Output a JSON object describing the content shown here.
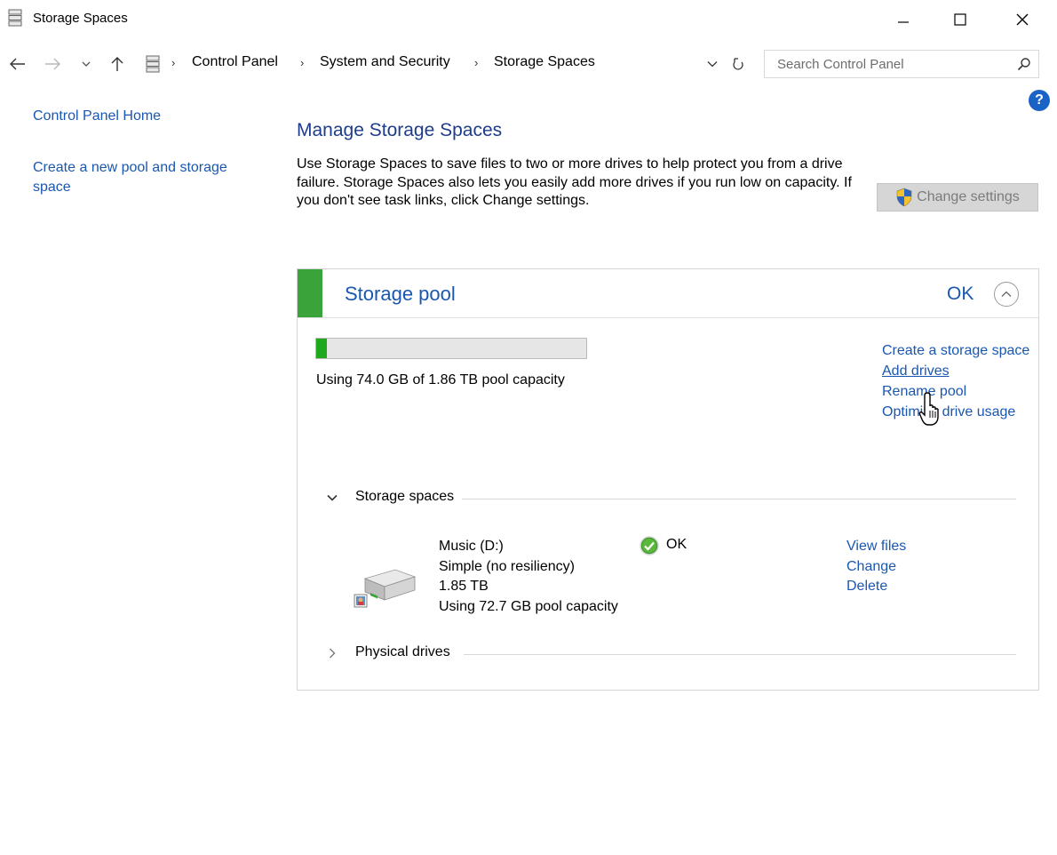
{
  "window": {
    "title": "Storage Spaces",
    "minimize_icon": "minimize-icon",
    "maximize_icon": "maximize-icon",
    "close_icon": "close-icon"
  },
  "address_bar": {
    "breadcrumbs": [
      "Control Panel",
      "System and Security",
      "Storage Spaces"
    ],
    "search_placeholder": "Search Control Panel"
  },
  "left_pane": {
    "links": [
      "Control Panel Home",
      "Create a new pool and storage space"
    ]
  },
  "main": {
    "title": "Manage Storage Spaces",
    "description": "Use Storage Spaces to save files to two or more drives to help protect you from a drive failure. Storage Spaces also lets you easily add more drives if you run low on capacity. If you don't see task links, click Change settings.",
    "change_settings_label": "Change settings"
  },
  "pool": {
    "title": "Storage pool",
    "status": "OK",
    "usage_fraction": 0.04,
    "usage_text": "Using 74.0 GB of 1.86 TB pool capacity",
    "actions": [
      "Create a storage space",
      "Add drives",
      "Rename pool",
      "Optimize drive usage"
    ],
    "storage_spaces_label": "Storage spaces",
    "physical_drives_label": "Physical drives",
    "accent_color": "#3aa33a"
  },
  "space": {
    "name": "Music (D:)",
    "resiliency": "Simple (no resiliency)",
    "size": "1.85 TB",
    "usage": "Using 72.7 GB pool capacity",
    "status": "OK",
    "actions": [
      "View files",
      "Change",
      "Delete"
    ]
  }
}
